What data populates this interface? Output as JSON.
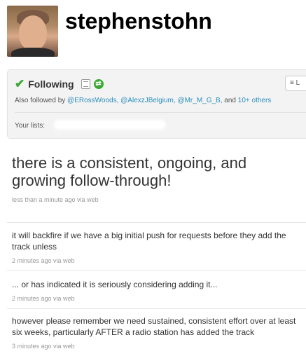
{
  "profile": {
    "username": "stephenstohn"
  },
  "follow_box": {
    "following_label": "Following",
    "list_button_label": "L",
    "also_followed_prefix": "Also followed by",
    "followers": [
      "@ERossWoods,",
      "@AlexzJBelgium,",
      "@Mr_M_G_B,"
    ],
    "and_text": "and",
    "more_link": "10+ others",
    "your_lists_label": "Your lists:"
  },
  "featured_tweet": {
    "text": "there is a consistent, ongoing, and growing follow-through!",
    "meta": "less than a minute ago via web"
  },
  "tweets": [
    {
      "text": "it will backfire if we have a big initial push for requests before they add the track unless",
      "meta": "2 minutes ago via web"
    },
    {
      "text": "... or has indicated it is seriously considering adding it...",
      "meta": "2 minutes ago via web"
    },
    {
      "text": "however please remember we need sustained, consistent effort over at least six weeks, particularly AFTER a radio station has added the track",
      "meta": "3 minutes ago via web"
    }
  ],
  "colors": {
    "link": "#2a8fbd",
    "check": "#3aa832",
    "box_bg": "#f3f3f3"
  },
  "icons": [
    "check-icon",
    "device-icon",
    "retweet-icon",
    "list-icon"
  ]
}
